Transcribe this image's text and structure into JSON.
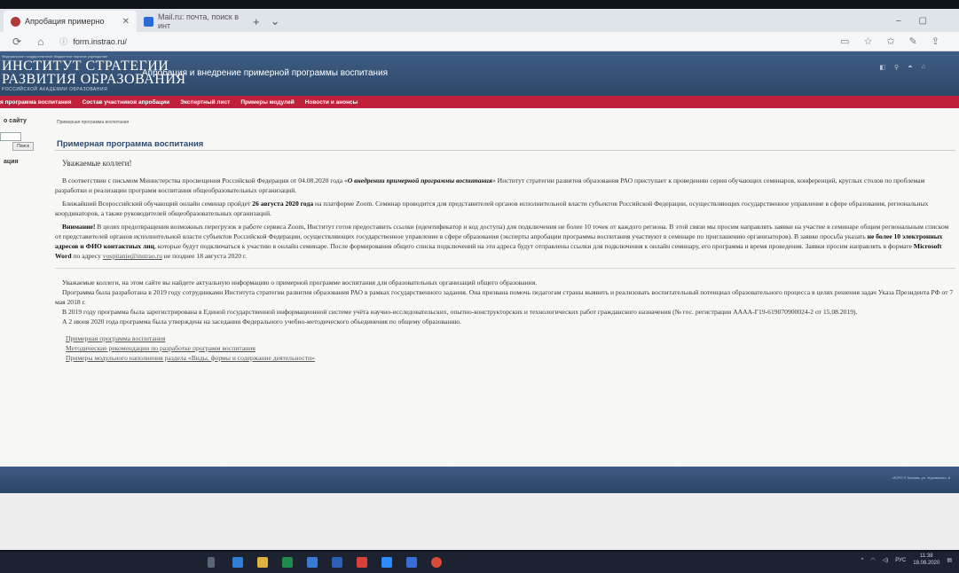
{
  "browser": {
    "tabs": [
      {
        "label": "Апробация примерно",
        "active": true
      },
      {
        "label": "Mail.ru: почта, поиск в инт",
        "active": false
      }
    ],
    "new_tab": "+",
    "window_controls": [
      "–",
      "▢",
      "✕"
    ],
    "url": "form.instrao.ru/"
  },
  "site": {
    "logo_small": "Федеральное государственное бюджетное научное учреждение",
    "logo_line1": "ИНСТИТУТ СТРАТЕГИИ",
    "logo_line2": "РАЗВИТИЯ ОБРАЗОВАНИЯ",
    "logo_line3": "РОССИЙСКОЙ АКАДЕМИИ ОБРАЗОВАНИЯ",
    "title": "Апробация и внедрение примерной программы воспитания",
    "menu": [
      "я программа воспитания",
      "Состав участников апробации",
      "Экспертный лист",
      "Примеры модулей",
      "Новости и анонсы"
    ]
  },
  "sidebar": {
    "title": "о сайту",
    "search_button": "Поиск",
    "item": "ация"
  },
  "main": {
    "breadcrumb": "Примерная программа воспитания",
    "title": "Примерная программа воспитания",
    "greeting": "Уважаемые коллеги!",
    "p1_start": "В соответствии с письмом Министерства просвещения Российской Федерации от 04.08.2020 года «",
    "p1_bold": "О внедрении примерной программы воспитания",
    "p1_end": "» Институт стратегии развития образования РАО приступает к проведению серии обучающих семинаров, конференций, круглых столов по проблемам разработки и реализации программ воспитания общеобразовательных организаций.",
    "p2_start": "Ближайший Всероссийский обучающий онлайн семинар пройдет ",
    "p2_bold": "26 августа 2020 года",
    "p2_end": " на платформе Zoom. Семинар проводится для представителей органов исполнительной власти субъектов Российской Федерации, осуществляющих государственное управление в сфере образования, региональных координаторов, а также руководителей общеобразовательных организаций.",
    "p3_bold1": "Внимание!",
    "p3_a": " В целях предотвращения возможных перегрузок в работе сервиса Zoom, Институт готов предоставить ссылки (идентификатор и код доступа) для подключения не более 10 точек от каждого региона. В этой связи мы просим направлять заявки на участие в семинаре общим региональным списком от представителей органов исполнительной власти субъектов Российской Федерации, осуществляющих государственное управление в сфере образования (эксперты апробации программы воспитания участвуют в семинаре по приглашению организаторов). В заявке просьба указать ",
    "p3_bold2": "не более 10 электронных адресов и ФИО контактных лиц",
    "p3_b": ", которые будут подключаться к участию в онлайн семинаре. После формирования общего списка подключений на эти адреса будут отправлены ссылки для подключения к онлайн семинару, его программа и время проведения. Заявки просим направлять в формате ",
    "p3_bold3": "Microsoft Word",
    "p3_c": " по адресу ",
    "p3_email": "vospitanie@instrao.ru",
    "p3_d": " не позднее 18 августа 2020 г.",
    "p4": "Уважаемые коллеги, на этом сайте вы найдете актуальную информацию о примерной программе воспитания для образовательных организаций общего образования.",
    "p5": "Программа была разработана в 2019 году сотрудниками Института стратегии развития образования РАО в рамках государственного задания. Она призвана помочь педагогам страны выявить и реализовать воспитательный потенциал образовательного процесса в целях решения задач Указа Президента РФ от 7 мая 2018 г.",
    "p6": "В 2019 году программа была зарегистрирована в Единой государственной информационной системе учёта научно-исследовательских, опытно-конструкторских и технологических работ гражданского назначения (№ гос. регистрации АААА-Г19-619070900024-2 от 15.08.2019).",
    "p7": "А 2 июня 2020 года программа была утверждена на заседании Федерального учебно-методического объединения по общему образованию.",
    "links": [
      "Примерная программа воспитания",
      "Методические рекомендации по разработке программ воспитания",
      "Примеры модульного наполнения раздела «Виды, формы и содержание деятельности»"
    ]
  },
  "footer": {
    "text": "ИСРО © Москва, ул. Жуковского, 8"
  },
  "taskbar": {
    "lang": "РУС",
    "time": "11:38",
    "date": "18.08.2020"
  }
}
